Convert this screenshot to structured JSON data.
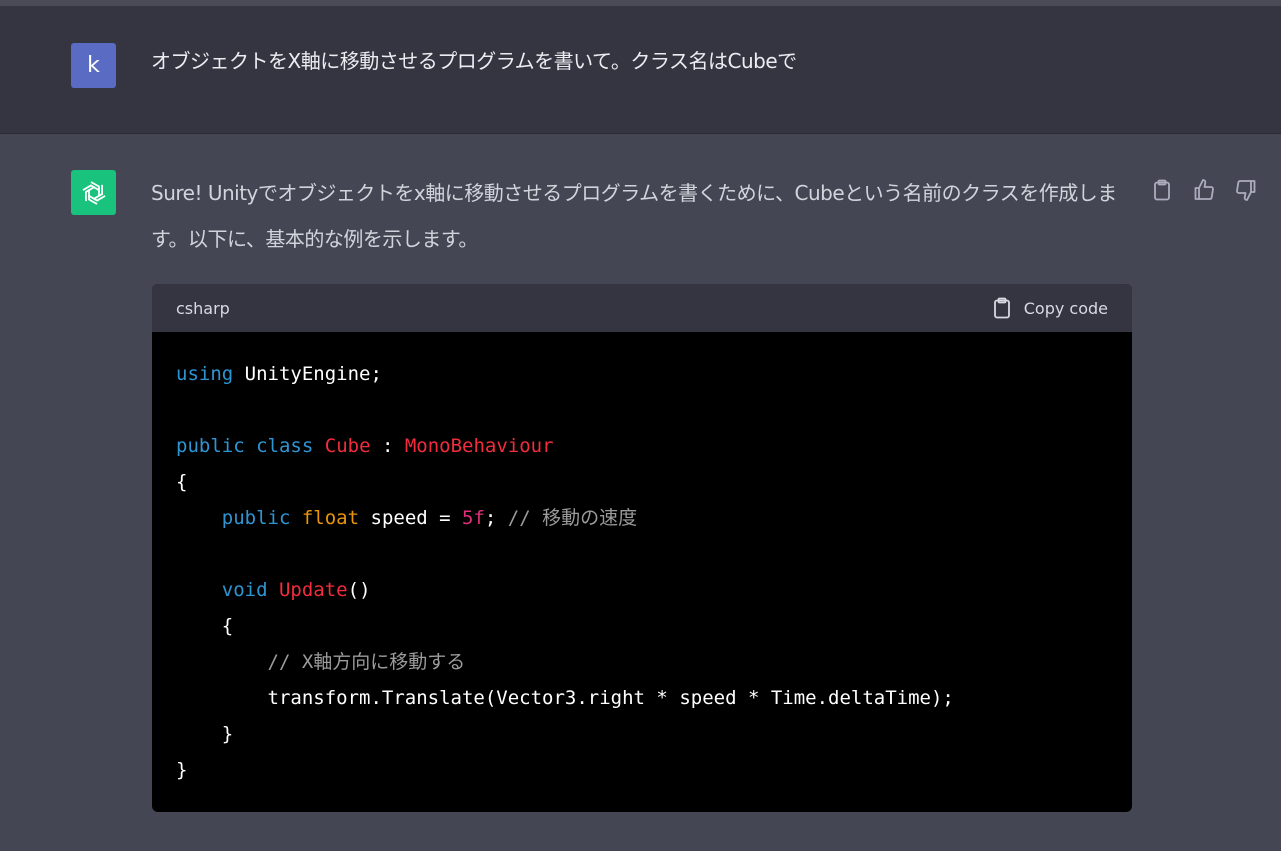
{
  "user_message": {
    "avatar_letter": "k",
    "text": "オブジェクトをX軸に移動させるプログラムを書いて。クラス名はCubeで"
  },
  "assistant_message": {
    "avatar_icon": "openai-logo-icon",
    "text": "Sure! Unityでオブジェクトをx軸に移動させるプログラムを書くために、Cubeという名前のクラスを作成します。以下に、基本的な例を示します。",
    "feedback_icons": [
      "clipboard-icon",
      "thumbs-up-icon",
      "thumbs-down-icon"
    ]
  },
  "code_block": {
    "language": "csharp",
    "copy_label": "Copy code",
    "lines": [
      [
        {
          "t": "using",
          "c": "kw"
        },
        {
          "t": " UnityEngine;",
          "c": ""
        }
      ],
      [],
      [
        {
          "t": "public",
          "c": "kw"
        },
        {
          "t": " ",
          "c": ""
        },
        {
          "t": "class",
          "c": "kw"
        },
        {
          "t": " ",
          "c": ""
        },
        {
          "t": "Cube",
          "c": "cls"
        },
        {
          "t": " : ",
          "c": ""
        },
        {
          "t": "MonoBehaviour",
          "c": "cls"
        }
      ],
      [
        {
          "t": "{",
          "c": ""
        }
      ],
      [
        {
          "t": "    ",
          "c": ""
        },
        {
          "t": "public",
          "c": "kw"
        },
        {
          "t": " ",
          "c": ""
        },
        {
          "t": "float",
          "c": "type"
        },
        {
          "t": " speed = ",
          "c": ""
        },
        {
          "t": "5f",
          "c": "num"
        },
        {
          "t": "; ",
          "c": ""
        },
        {
          "t": "// 移動の速度",
          "c": "cmt"
        }
      ],
      [],
      [
        {
          "t": "    ",
          "c": ""
        },
        {
          "t": "void",
          "c": "kw"
        },
        {
          "t": " ",
          "c": ""
        },
        {
          "t": "Update",
          "c": "cls"
        },
        {
          "t": "()",
          "c": ""
        }
      ],
      [
        {
          "t": "    {",
          "c": ""
        }
      ],
      [
        {
          "t": "        ",
          "c": ""
        },
        {
          "t": "// X軸方向に移動する",
          "c": "cmt"
        }
      ],
      [
        {
          "t": "        transform.Translate(Vector3.right * speed * Time.deltaTime);",
          "c": ""
        }
      ],
      [
        {
          "t": "    }",
          "c": ""
        }
      ],
      [
        {
          "t": "}",
          "c": ""
        }
      ]
    ]
  },
  "colors": {
    "user_bg": "#343541",
    "assistant_bg": "#444654",
    "user_avatar": "#5a6bc4",
    "gpt_avatar": "#19c37d",
    "code_keyword": "#2e95d3",
    "code_class": "#f22c3d",
    "code_type": "#e9950c",
    "code_number": "#df3079",
    "code_comment": "#9b9b9b"
  }
}
